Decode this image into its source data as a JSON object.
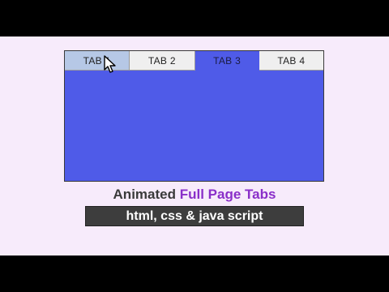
{
  "tabs": [
    {
      "label": "TAB 1",
      "state": "hover"
    },
    {
      "label": "TAB 2",
      "state": "normal"
    },
    {
      "label": "TAB 3",
      "state": "active"
    },
    {
      "label": "TAB 4",
      "state": "normal"
    }
  ],
  "panel": {
    "color": "#4f5be8"
  },
  "caption": {
    "prefix": "Animated",
    "highlight": "Full Page Tabs"
  },
  "subcaption": {
    "text": "html, css & java script"
  },
  "colors": {
    "background": "#f7ebfb",
    "accent": "#8a2fc9",
    "hover_tab": "#b6c8e6"
  }
}
